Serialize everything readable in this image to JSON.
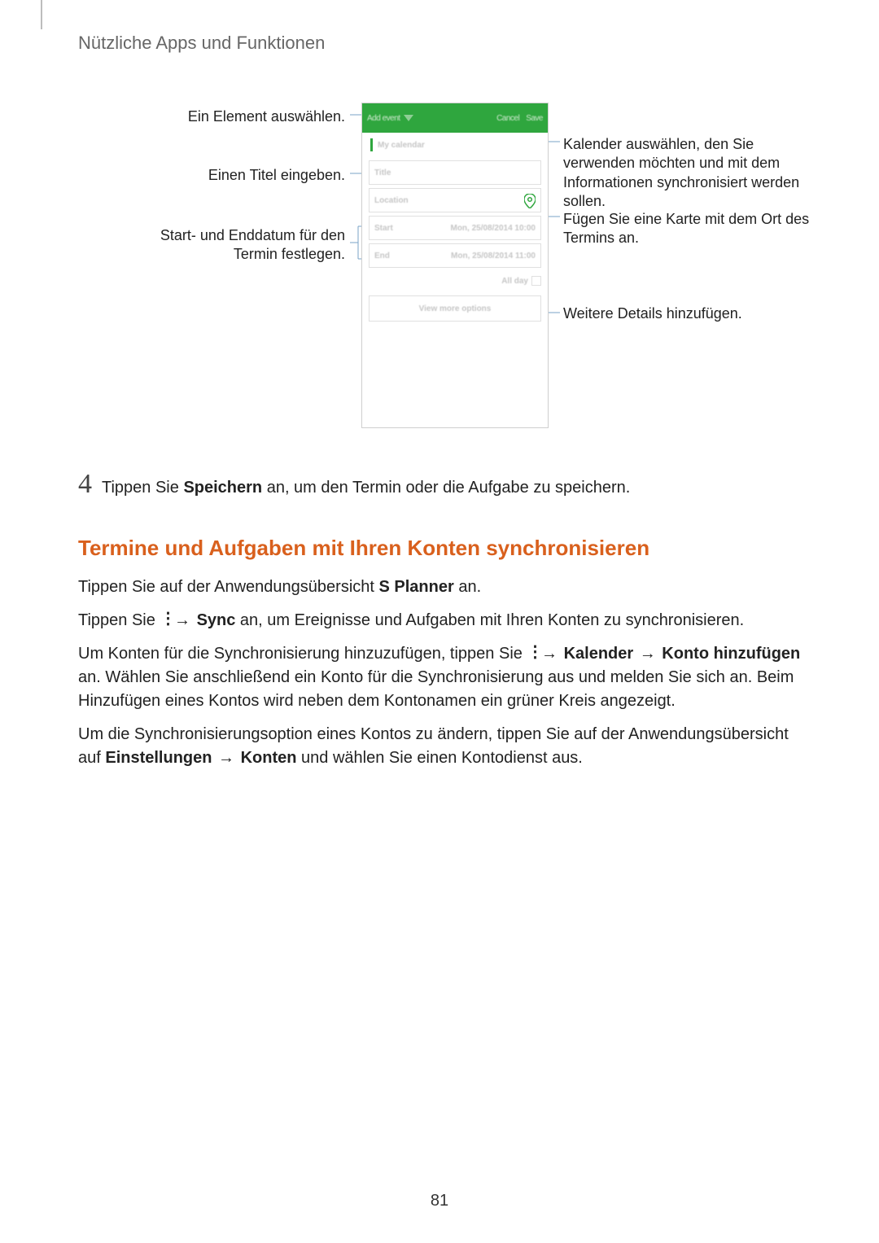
{
  "header": {
    "breadcrumb": "Nützliche Apps und Funktionen"
  },
  "diagram": {
    "left": {
      "select_element": "Ein Element auswählen.",
      "enter_title": "Einen Titel eingeben.",
      "start_end": "Start- und Enddatum für den Termin festlegen."
    },
    "right": {
      "select_calendar": "Kalender auswählen, den Sie verwenden möchten und mit dem Informationen synchronisiert werden sollen.",
      "add_map": "Fügen Sie eine Karte mit dem Ort des Termins an.",
      "more_details": "Weitere Details hinzufügen."
    },
    "phone": {
      "header_add": "Add event",
      "header_cancel": "Cancel",
      "header_save": "Save",
      "my_calendar": "My calendar",
      "title_placeholder": "Title",
      "location_placeholder": "Location",
      "start_label": "Start",
      "start_value": "Mon, 25/08/2014   10:00",
      "end_label": "End",
      "end_value": "Mon, 25/08/2014   11:00",
      "all_day": "All day",
      "view_more": "View more options"
    }
  },
  "step4": {
    "num": "4",
    "prefix": "Tippen Sie ",
    "bold": "Speichern",
    "suffix": " an, um den Termin oder die Aufgabe zu speichern."
  },
  "section": {
    "title": "Termine und Aufgaben mit Ihren Konten synchronisieren"
  },
  "para1": {
    "p1": "Tippen Sie auf der Anwendungsübersicht ",
    "b1": "S Planner",
    "p2": " an."
  },
  "para2": {
    "p1": "Tippen Sie ",
    "arrow": " → ",
    "b1": "Sync",
    "p2": " an, um Ereignisse und Aufgaben mit Ihren Konten zu synchronisieren."
  },
  "para3": {
    "p1": "Um Konten für die Synchronisierung hinzuzufügen, tippen Sie ",
    "arrow1": " → ",
    "b1": "Kalender",
    "arrow2": " → ",
    "b2": "Konto hinzufügen",
    "p2": " an. Wählen Sie anschließend ein Konto für die Synchronisierung aus und melden Sie sich an. Beim Hinzufügen eines Kontos wird neben dem Kontonamen ein grüner Kreis angezeigt."
  },
  "para4": {
    "p1": "Um die Synchronisierungsoption eines Kontos zu ändern, tippen Sie auf der Anwendungsübersicht auf ",
    "b1": "Einstellungen",
    "arrow": " → ",
    "b2": "Konten",
    "p2": " und wählen Sie einen Kontodienst aus."
  },
  "page_number": "81",
  "icons": {
    "kebab": "⋮"
  }
}
